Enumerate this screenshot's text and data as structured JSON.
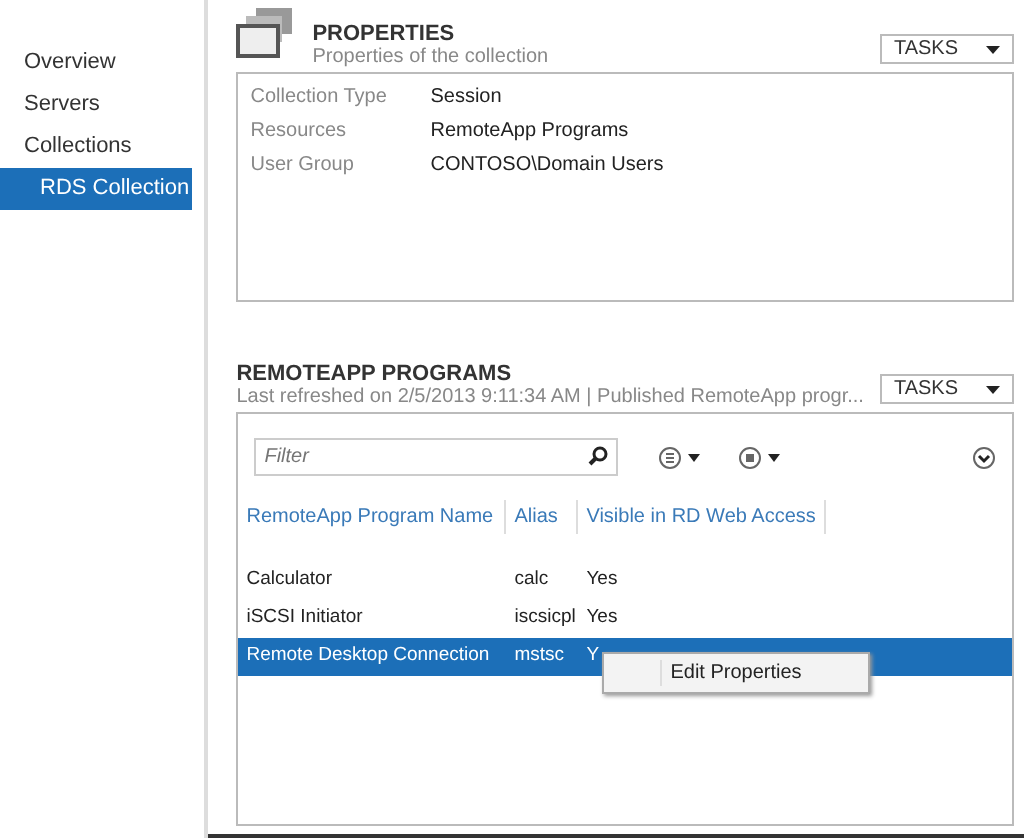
{
  "sidebar": {
    "items": [
      {
        "label": "Overview",
        "selected": false
      },
      {
        "label": "Servers",
        "selected": false
      },
      {
        "label": "Collections",
        "selected": false
      },
      {
        "label": "RDS Collection",
        "selected": true,
        "kind": "child"
      }
    ]
  },
  "properties": {
    "title": "PROPERTIES",
    "subtitle": "Properties of the collection",
    "tasks": "TASKS",
    "fields": [
      {
        "label": "Collection Type",
        "value": "Session"
      },
      {
        "label": "Resources",
        "value": "RemoteApp Programs"
      },
      {
        "label": "User Group",
        "value": "CONTOSO\\Domain Users"
      }
    ]
  },
  "programs": {
    "title": "REMOTEAPP PROGRAMS",
    "subtitle": "Last refreshed on 2/5/2013 9:11:34 AM | Published RemoteApp progr...",
    "tasks": "TASKS",
    "filter": {
      "placeholder": "Filter"
    },
    "columns": [
      "RemoteApp Program Name",
      "Alias",
      "Visible in RD Web Access"
    ],
    "rows": [
      {
        "cells": [
          "Calculator",
          "calc",
          "Yes"
        ],
        "selected": false
      },
      {
        "cells": [
          "iSCSI Initiator",
          "iscsicpl",
          "Yes"
        ],
        "selected": false
      },
      {
        "cells": [
          "Remote Desktop Connection",
          "mstsc",
          "Y"
        ],
        "selected": true
      }
    ],
    "context_menu": [
      "Edit Properties"
    ]
  }
}
